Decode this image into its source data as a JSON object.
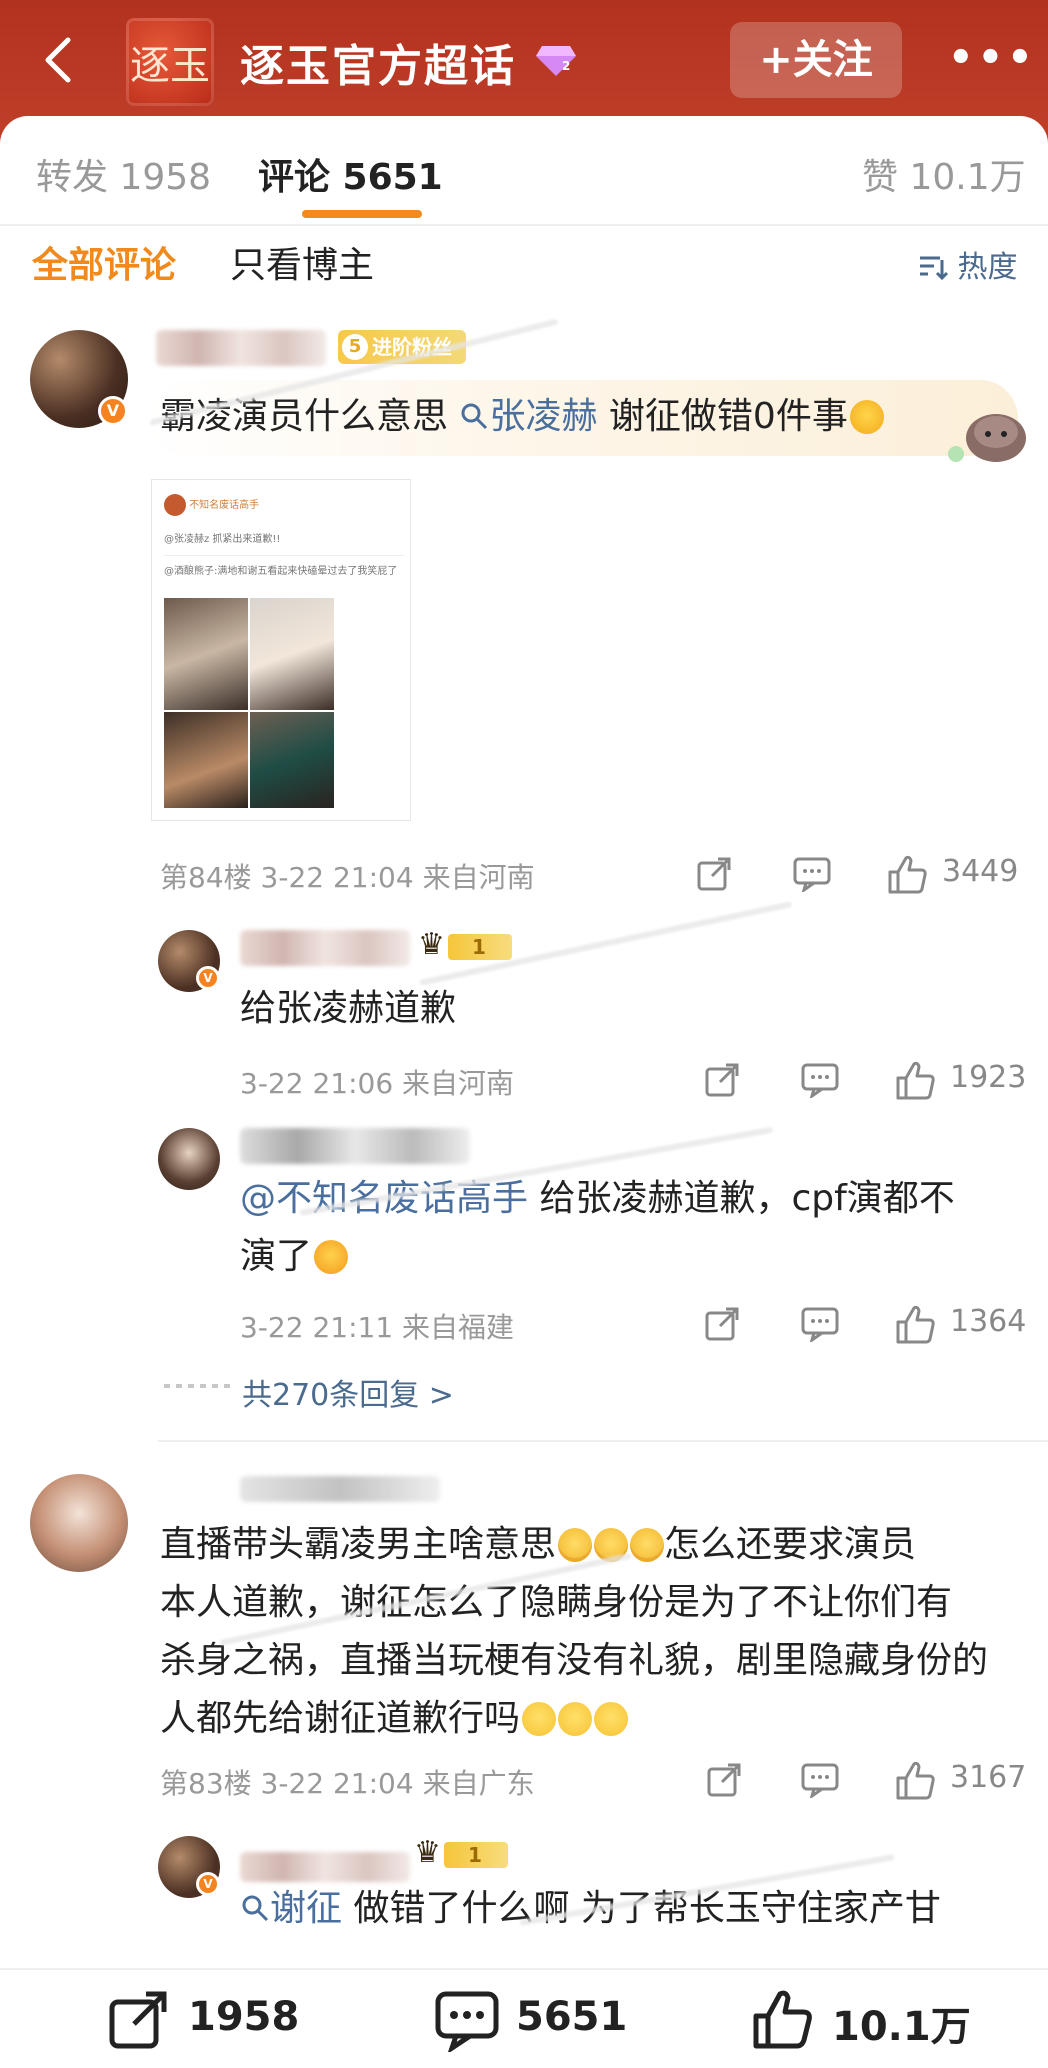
{
  "header": {
    "title": "逐玉官方超话",
    "logo_text": "逐玉",
    "follow_label": "+关注",
    "more_label": "•••"
  },
  "tabs": [
    {
      "label": "转发 1958"
    },
    {
      "label": "评论 5651"
    },
    {
      "label": "赞 10.1万"
    }
  ],
  "filters": {
    "all": "全部评论",
    "owner_only": "只看博主",
    "sort": "热度"
  },
  "comments": [
    {
      "badge_level": "5",
      "badge_text": "进阶粉丝",
      "text_before": "霸凌演员什么意思 ",
      "link": "张凌赫",
      "text_after": " 谢征做错0件事",
      "meta": "第84楼 3-22 21:04 来自河南",
      "likes": "3449",
      "embedded": {
        "user": "不知名废话高手",
        "line1": "@张凌赫z 抓紧出来道歉!!",
        "line2": "@酒酿熊子:满地和谢五看起来快磕晕过去了我笑屁了"
      }
    },
    {
      "badge_level": "",
      "text_before": "直播带头霸凌男主啥意思",
      "text_line2": "本人道歉，谢征怎么了隐瞒身份是为了不让你们有",
      "text_line3": "杀身之祸，直播当玩梗有没有礼貌，剧里隐藏身份的",
      "text_line4": "人都先给谢征道歉行吗",
      "text_after": "怎么还要求演员",
      "meta": "第83楼 3-22 21:04 来自广东",
      "likes": "3167"
    }
  ],
  "replies": [
    {
      "badge_level": "1",
      "text": "给张凌赫道歉",
      "meta": "3-22 21:06 来自河南",
      "likes": "1923"
    },
    {
      "mention": "@不知名废话高手",
      "text": " 给张凌赫道歉，cpf演都不",
      "text_line2": "演了",
      "meta": "3-22 21:11 来自福建",
      "likes": "1364"
    },
    {
      "badge_level": "1",
      "link": "谢征",
      "text": " 做错了什么啊 为了帮长玉守住家产甘"
    }
  ],
  "more_replies": "共270条回复 >",
  "bottom_bar": {
    "reposts": "1958",
    "comments": "5651",
    "likes": "10.1万"
  }
}
